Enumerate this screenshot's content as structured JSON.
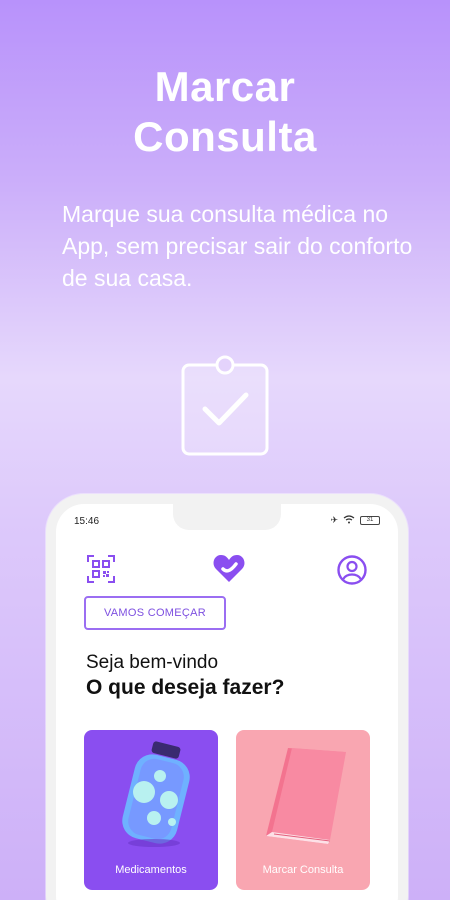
{
  "hero": {
    "title_line1": "Marcar",
    "title_line2": "Consulta",
    "subtitle": "Marque sua consulta médica no App, sem precisar sair do conforto de sua casa."
  },
  "icons": {
    "hero": "clipboard-check-icon",
    "header_left": "qr-code-icon",
    "logo": "heart-logo-icon",
    "header_right": "user-profile-icon"
  },
  "status_bar": {
    "time": "15:46",
    "battery": "31"
  },
  "app": {
    "start_button": "VAMOS COMEÇAR",
    "greeting": "Seja bem-vindo",
    "question": "O que deseja fazer?",
    "cards": [
      {
        "label": "Medicamentos",
        "color": "#8a4ef0"
      },
      {
        "label": "Marcar Consulta",
        "color": "#f9a6b1"
      }
    ]
  },
  "colors": {
    "accent": "#9b6ef2",
    "background_top": "#b892fb",
    "background_mid": "#e6d8fc"
  }
}
